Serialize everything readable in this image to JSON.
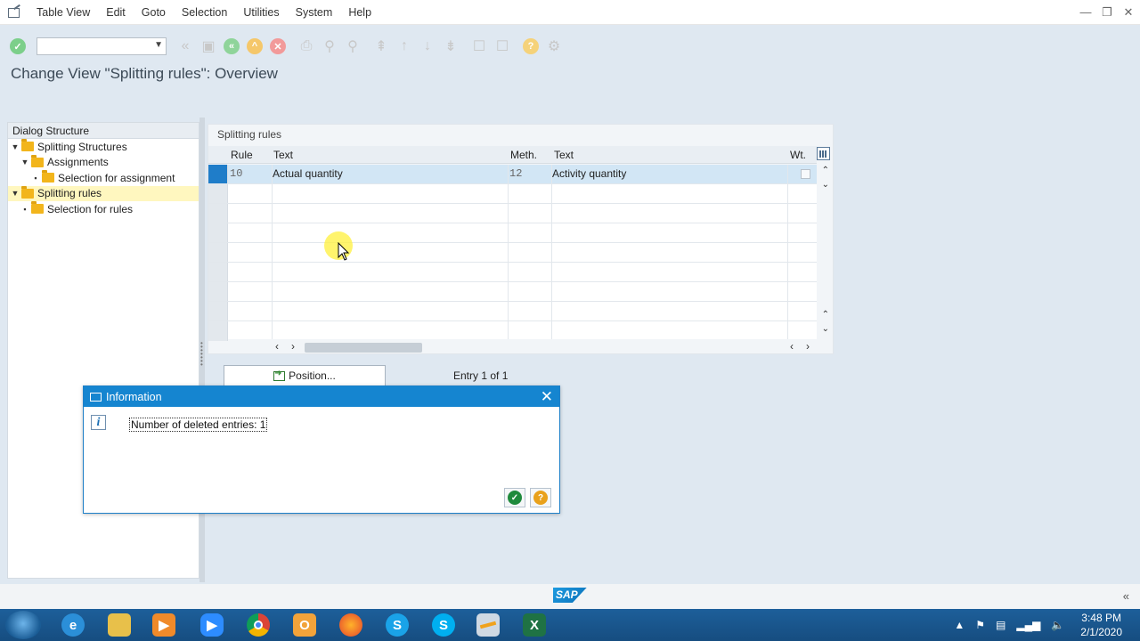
{
  "menu": [
    "Table View",
    "Edit",
    "Goto",
    "Selection",
    "Utilities",
    "System",
    "Help"
  ],
  "window_controls": [
    "—",
    "❐",
    "✕"
  ],
  "page_title": "Change View \"Splitting rules\": Overview",
  "left_panel": {
    "header": "Dialog Structure",
    "tree": [
      {
        "label": "Splitting Structures",
        "level": 0,
        "expanded": true
      },
      {
        "label": "Assignments",
        "level": 1,
        "expanded": true
      },
      {
        "label": "Selection for assignment",
        "level": 2
      },
      {
        "label": "Splitting rules",
        "level": 0,
        "expanded": true,
        "selected": true
      },
      {
        "label": "Selection for rules",
        "level": 1
      }
    ]
  },
  "table": {
    "caption": "Splitting rules",
    "columns": [
      "Rule",
      "Text",
      "Meth.",
      "Text",
      "Wt."
    ],
    "rows": [
      {
        "rule": "10",
        "text": "Actual quantity",
        "meth": "12",
        "meth_text": "Activity quantity",
        "wt": false
      }
    ]
  },
  "position_button": "Position...",
  "entry_info": "Entry 1 of 1",
  "dialog": {
    "title": "Information",
    "message": "Number of deleted entries: 1"
  },
  "taskbar": {
    "time": "3:48 PM",
    "date": "2/1/2020"
  },
  "colors": {
    "accent": "#1585d0",
    "selected_row": "#d2e6f5",
    "tree_selected": "#fff7bf"
  }
}
